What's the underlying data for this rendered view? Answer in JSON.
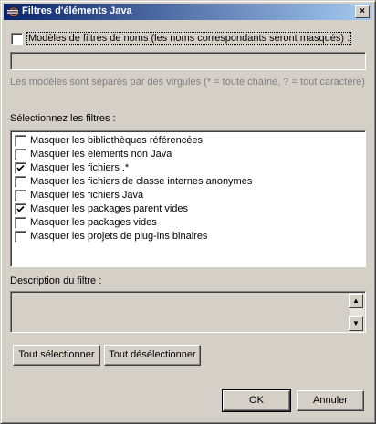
{
  "window": {
    "title": "Filtres d'éléments Java",
    "close_glyph": "×"
  },
  "patterns": {
    "checkbox_label": "Modèles de filtres de noms (les noms correspondants seront masqués) :",
    "checked": false,
    "value": "",
    "hint": "Les modèles sont séparés par des virgules (* = toute chaîne, ? = tout caractère)"
  },
  "filters": {
    "label": "Sélectionnez les filtres :",
    "items": [
      {
        "label": "Masquer les bibliothèques référencées",
        "checked": false
      },
      {
        "label": "Masquer les éléments non Java",
        "checked": false
      },
      {
        "label": "Masquer les fichiers .*",
        "checked": true
      },
      {
        "label": "Masquer les fichiers de classe internes anonymes",
        "checked": false
      },
      {
        "label": "Masquer les fichiers Java",
        "checked": false
      },
      {
        "label": "Masquer les packages parent vides",
        "checked": true
      },
      {
        "label": "Masquer les packages vides",
        "checked": false
      },
      {
        "label": "Masquer les projets de plug-ins binaires",
        "checked": false
      }
    ]
  },
  "description": {
    "label": "Description du filtre :",
    "value": ""
  },
  "buttons": {
    "select_all": "Tout sélectionner",
    "deselect_all": "Tout désélectionner",
    "ok": "OK",
    "cancel": "Annuler"
  },
  "icons": {
    "app": "eclipse-icon",
    "scroll_up": "scroll-up-icon",
    "scroll_down": "scroll-down-icon"
  }
}
